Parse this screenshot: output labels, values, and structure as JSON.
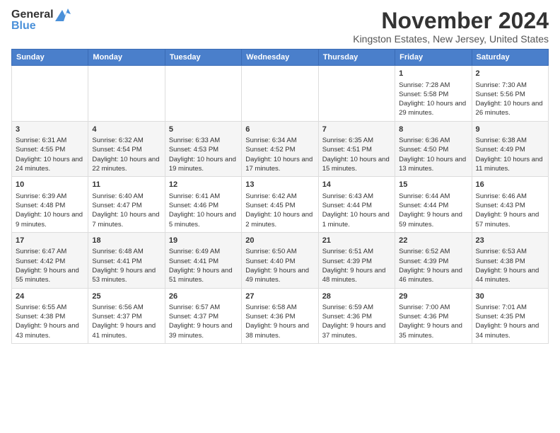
{
  "logo": {
    "line1": "General",
    "line2": "Blue",
    "tagline": ""
  },
  "title": "November 2024",
  "location": "Kingston Estates, New Jersey, United States",
  "days_of_week": [
    "Sunday",
    "Monday",
    "Tuesday",
    "Wednesday",
    "Thursday",
    "Friday",
    "Saturday"
  ],
  "weeks": [
    [
      {
        "day": "",
        "info": ""
      },
      {
        "day": "",
        "info": ""
      },
      {
        "day": "",
        "info": ""
      },
      {
        "day": "",
        "info": ""
      },
      {
        "day": "",
        "info": ""
      },
      {
        "day": "1",
        "info": "Sunrise: 7:28 AM\nSunset: 5:58 PM\nDaylight: 10 hours and 29 minutes."
      },
      {
        "day": "2",
        "info": "Sunrise: 7:30 AM\nSunset: 5:56 PM\nDaylight: 10 hours and 26 minutes."
      }
    ],
    [
      {
        "day": "3",
        "info": "Sunrise: 6:31 AM\nSunset: 4:55 PM\nDaylight: 10 hours and 24 minutes."
      },
      {
        "day": "4",
        "info": "Sunrise: 6:32 AM\nSunset: 4:54 PM\nDaylight: 10 hours and 22 minutes."
      },
      {
        "day": "5",
        "info": "Sunrise: 6:33 AM\nSunset: 4:53 PM\nDaylight: 10 hours and 19 minutes."
      },
      {
        "day": "6",
        "info": "Sunrise: 6:34 AM\nSunset: 4:52 PM\nDaylight: 10 hours and 17 minutes."
      },
      {
        "day": "7",
        "info": "Sunrise: 6:35 AM\nSunset: 4:51 PM\nDaylight: 10 hours and 15 minutes."
      },
      {
        "day": "8",
        "info": "Sunrise: 6:36 AM\nSunset: 4:50 PM\nDaylight: 10 hours and 13 minutes."
      },
      {
        "day": "9",
        "info": "Sunrise: 6:38 AM\nSunset: 4:49 PM\nDaylight: 10 hours and 11 minutes."
      }
    ],
    [
      {
        "day": "10",
        "info": "Sunrise: 6:39 AM\nSunset: 4:48 PM\nDaylight: 10 hours and 9 minutes."
      },
      {
        "day": "11",
        "info": "Sunrise: 6:40 AM\nSunset: 4:47 PM\nDaylight: 10 hours and 7 minutes."
      },
      {
        "day": "12",
        "info": "Sunrise: 6:41 AM\nSunset: 4:46 PM\nDaylight: 10 hours and 5 minutes."
      },
      {
        "day": "13",
        "info": "Sunrise: 6:42 AM\nSunset: 4:45 PM\nDaylight: 10 hours and 2 minutes."
      },
      {
        "day": "14",
        "info": "Sunrise: 6:43 AM\nSunset: 4:44 PM\nDaylight: 10 hours and 1 minute."
      },
      {
        "day": "15",
        "info": "Sunrise: 6:44 AM\nSunset: 4:44 PM\nDaylight: 9 hours and 59 minutes."
      },
      {
        "day": "16",
        "info": "Sunrise: 6:46 AM\nSunset: 4:43 PM\nDaylight: 9 hours and 57 minutes."
      }
    ],
    [
      {
        "day": "17",
        "info": "Sunrise: 6:47 AM\nSunset: 4:42 PM\nDaylight: 9 hours and 55 minutes."
      },
      {
        "day": "18",
        "info": "Sunrise: 6:48 AM\nSunset: 4:41 PM\nDaylight: 9 hours and 53 minutes."
      },
      {
        "day": "19",
        "info": "Sunrise: 6:49 AM\nSunset: 4:41 PM\nDaylight: 9 hours and 51 minutes."
      },
      {
        "day": "20",
        "info": "Sunrise: 6:50 AM\nSunset: 4:40 PM\nDaylight: 9 hours and 49 minutes."
      },
      {
        "day": "21",
        "info": "Sunrise: 6:51 AM\nSunset: 4:39 PM\nDaylight: 9 hours and 48 minutes."
      },
      {
        "day": "22",
        "info": "Sunrise: 6:52 AM\nSunset: 4:39 PM\nDaylight: 9 hours and 46 minutes."
      },
      {
        "day": "23",
        "info": "Sunrise: 6:53 AM\nSunset: 4:38 PM\nDaylight: 9 hours and 44 minutes."
      }
    ],
    [
      {
        "day": "24",
        "info": "Sunrise: 6:55 AM\nSunset: 4:38 PM\nDaylight: 9 hours and 43 minutes."
      },
      {
        "day": "25",
        "info": "Sunrise: 6:56 AM\nSunset: 4:37 PM\nDaylight: 9 hours and 41 minutes."
      },
      {
        "day": "26",
        "info": "Sunrise: 6:57 AM\nSunset: 4:37 PM\nDaylight: 9 hours and 39 minutes."
      },
      {
        "day": "27",
        "info": "Sunrise: 6:58 AM\nSunset: 4:36 PM\nDaylight: 9 hours and 38 minutes."
      },
      {
        "day": "28",
        "info": "Sunrise: 6:59 AM\nSunset: 4:36 PM\nDaylight: 9 hours and 37 minutes."
      },
      {
        "day": "29",
        "info": "Sunrise: 7:00 AM\nSunset: 4:36 PM\nDaylight: 9 hours and 35 minutes."
      },
      {
        "day": "30",
        "info": "Sunrise: 7:01 AM\nSunset: 4:35 PM\nDaylight: 9 hours and 34 minutes."
      }
    ]
  ]
}
